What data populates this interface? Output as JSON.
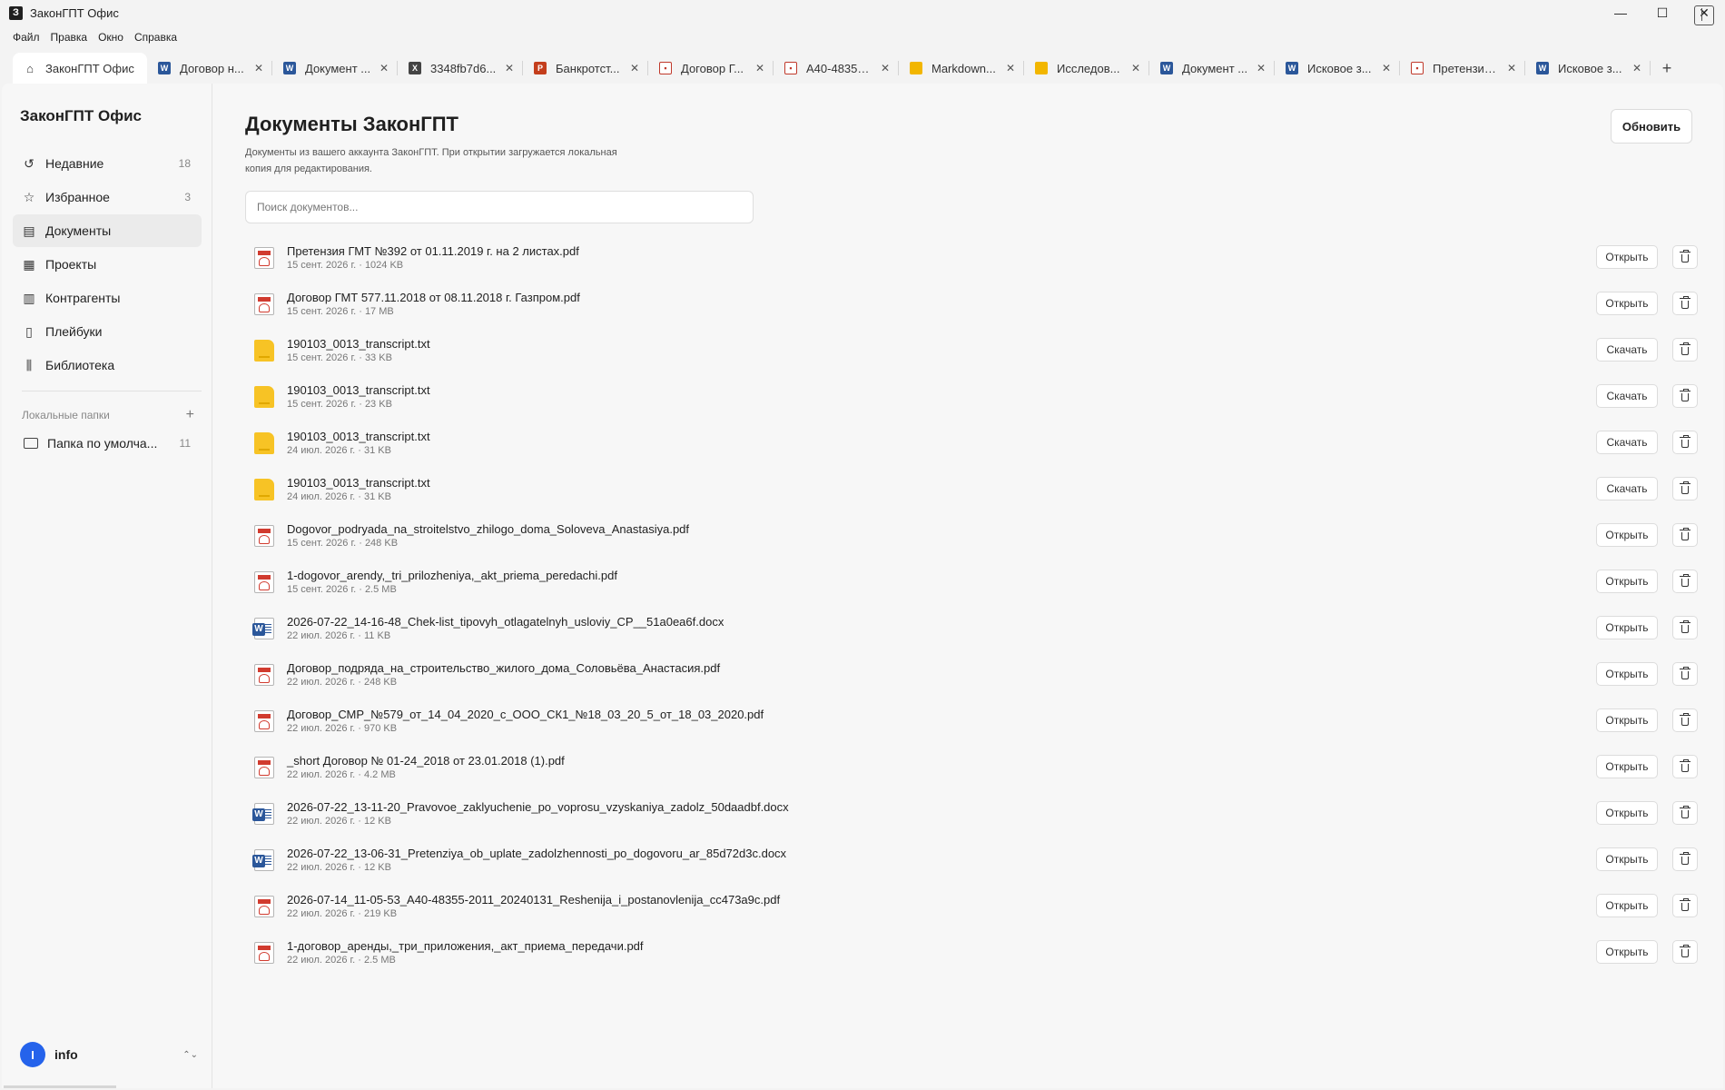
{
  "window": {
    "title": "ЗаконГПТ Офис",
    "app_icon_letter": "З",
    "controls": {
      "minimize": "—",
      "maximize": "☐",
      "close": "✕"
    }
  },
  "menu": [
    "Файл",
    "Правка",
    "Окно",
    "Справка"
  ],
  "tabs": [
    {
      "label": "ЗаконГПТ Офис",
      "icon": "home-icon",
      "kind": "home",
      "active": true
    },
    {
      "label": "Договор н...",
      "icon": "word-icon",
      "kind": "word"
    },
    {
      "label": "Документ ...",
      "icon": "word-icon",
      "kind": "word"
    },
    {
      "label": "3348fb7d6...",
      "icon": "excel-icon",
      "kind": "xls"
    },
    {
      "label": "Банкротст...",
      "icon": "powerpoint-icon",
      "kind": "ppt"
    },
    {
      "label": "Договор Г...",
      "icon": "pdf-icon",
      "kind": "pdf"
    },
    {
      "label": "А40-48355...",
      "icon": "pdf-icon",
      "kind": "pdf"
    },
    {
      "label": "Markdown...",
      "icon": "file-icon",
      "kind": "folder"
    },
    {
      "label": "Исследов...",
      "icon": "file-icon",
      "kind": "folder"
    },
    {
      "label": "Документ ...",
      "icon": "word-icon",
      "kind": "word"
    },
    {
      "label": "Исковое з...",
      "icon": "word-icon",
      "kind": "word"
    },
    {
      "label": "Претензия...",
      "icon": "pdf-icon",
      "kind": "pdf"
    },
    {
      "label": "Исковое з...",
      "icon": "word-icon",
      "kind": "word"
    }
  ],
  "tab_add": "+",
  "sidebar": {
    "brand": "ЗаконГПТ Офис",
    "nav": [
      {
        "label": "Недавние",
        "count": "18",
        "icon": "history-icon",
        "glyph": "↺"
      },
      {
        "label": "Избранное",
        "count": "3",
        "icon": "star-icon",
        "glyph": "☆"
      },
      {
        "label": "Документы",
        "count": "",
        "icon": "document-icon",
        "glyph": "▤",
        "active": true
      },
      {
        "label": "Проекты",
        "count": "",
        "icon": "projects-icon",
        "glyph": "▦"
      },
      {
        "label": "Контрагенты",
        "count": "",
        "icon": "building-icon",
        "glyph": "▥"
      },
      {
        "label": "Плейбуки",
        "count": "",
        "icon": "book-icon",
        "glyph": "▯"
      },
      {
        "label": "Библиотека",
        "count": "",
        "icon": "library-icon",
        "glyph": "⫼"
      }
    ],
    "local_folders": {
      "title": "Локальные папки",
      "add": "+",
      "items": [
        {
          "label": "Папка по умолча...",
          "count": "11"
        }
      ]
    },
    "user": {
      "initial": "I",
      "name": "info",
      "chevron": "⌃⌄"
    }
  },
  "main": {
    "title": "Документы ЗаконГПТ",
    "subtitle": "Документы из вашего аккаунта ЗаконГПТ. При открытии загружается локальная копия для редактирования.",
    "refresh_label": "Обновить",
    "search_placeholder": "Поиск документов...",
    "delete_icon": "trash-icon",
    "documents": [
      {
        "name": "Претензия ГМТ №392 от 01.11.2019 г. на 2 листах.pdf",
        "meta": "15 сент. 2026 г. · 1024 KB",
        "type": "pdf",
        "action": "Открыть"
      },
      {
        "name": "Договор ГМТ 577.11.2018 от 08.11.2018 г. Газпром.pdf",
        "meta": "15 сент. 2026 г. · 17 MB",
        "type": "pdf",
        "action": "Открыть"
      },
      {
        "name": "190103_0013_transcript.txt",
        "meta": "15 сент. 2026 г. · 33 KB",
        "type": "txt",
        "action": "Скачать"
      },
      {
        "name": "190103_0013_transcript.txt",
        "meta": "15 сент. 2026 г. · 23 KB",
        "type": "txt",
        "action": "Скачать"
      },
      {
        "name": "190103_0013_transcript.txt",
        "meta": "24 июл. 2026 г. · 31 KB",
        "type": "txt",
        "action": "Скачать"
      },
      {
        "name": "190103_0013_transcript.txt",
        "meta": "24 июл. 2026 г. · 31 KB",
        "type": "txt",
        "action": "Скачать"
      },
      {
        "name": "Dogovor_podryada_na_stroitelstvo_zhilogo_doma_Soloveva_Anastasiya.pdf",
        "meta": "15 сент. 2026 г. · 248 KB",
        "type": "pdf",
        "action": "Открыть"
      },
      {
        "name": "1-dogovor_arendy,_tri_prilozheniya,_akt_priema_peredachi.pdf",
        "meta": "15 сент. 2026 г. · 2.5 MB",
        "type": "pdf",
        "action": "Открыть"
      },
      {
        "name": "2026-07-22_14-16-48_Chek-list_tipovyh_otlagatelnyh_usloviy_CP__51a0ea6f.docx",
        "meta": "22 июл. 2026 г. · 11 KB",
        "type": "docx",
        "action": "Открыть"
      },
      {
        "name": "Договор_подряда_на_строительство_жилого_дома_Соловьёва_Анастасия.pdf",
        "meta": "22 июл. 2026 г. · 248 KB",
        "type": "pdf",
        "action": "Открыть"
      },
      {
        "name": "Договор_СМР_№579_от_14_04_2020_с_ООО_СК1_№18_03_20_5_от_18_03_2020.pdf",
        "meta": "22 июл. 2026 г. · 970 KB",
        "type": "pdf",
        "action": "Открыть"
      },
      {
        "name": "_short Договор № 01-24_2018 от 23.01.2018 (1).pdf",
        "meta": "22 июл. 2026 г. · 4.2 MB",
        "type": "pdf",
        "action": "Открыть"
      },
      {
        "name": "2026-07-22_13-11-20_Pravovoe_zaklyuchenie_po_voprosu_vzyskaniya_zadolz_50daadbf.docx",
        "meta": "22 июл. 2026 г. · 12 KB",
        "type": "docx",
        "action": "Открыть"
      },
      {
        "name": "2026-07-22_13-06-31_Pretenziya_ob_uplate_zadolzhennosti_po_dogovoru_ar_85d72d3c.docx",
        "meta": "22 июл. 2026 г. · 12 KB",
        "type": "docx",
        "action": "Открыть"
      },
      {
        "name": "2026-07-14_11-05-53_A40-48355-2011_20240131_Reshenija_i_postanovlenija_cc473a9c.pdf",
        "meta": "22 июл. 2026 г. · 219 KB",
        "type": "pdf",
        "action": "Открыть"
      },
      {
        "name": "1-договор_аренды,_три_приложения,_акт_приема_передачи.pdf",
        "meta": "22 июл. 2026 г. · 2.5 MB",
        "type": "pdf",
        "action": "Открыть"
      }
    ]
  }
}
